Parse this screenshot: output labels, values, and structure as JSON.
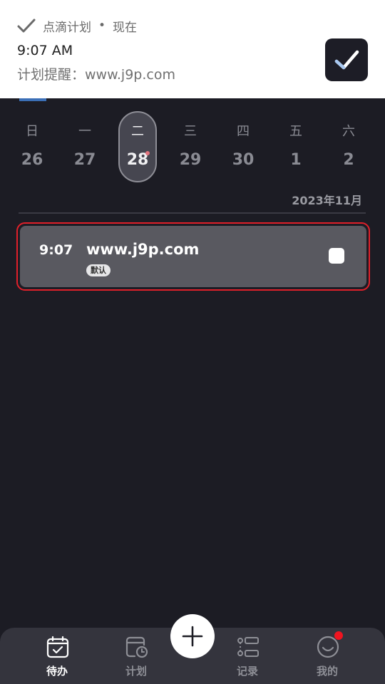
{
  "notification": {
    "app_name": "点滴计划",
    "separator": "•",
    "when": "现在",
    "time": "9:07 AM",
    "body": "计划提醒：www.j9p.com"
  },
  "calendar": {
    "days": [
      {
        "weekday": "日",
        "date": "26"
      },
      {
        "weekday": "一",
        "date": "27"
      },
      {
        "weekday": "二",
        "date": "28",
        "selected": true
      },
      {
        "weekday": "三",
        "date": "29"
      },
      {
        "weekday": "四",
        "date": "30"
      },
      {
        "weekday": "五",
        "date": "1"
      },
      {
        "weekday": "六",
        "date": "2"
      }
    ],
    "month": "2023年11月"
  },
  "task": {
    "time": "9:07",
    "title": "www.j9p.com",
    "tag": "默认"
  },
  "nav": {
    "items": [
      {
        "label": "待办",
        "icon": "todo-calendar-icon",
        "active": true
      },
      {
        "label": "计划",
        "icon": "plan-clock-icon"
      },
      {
        "label": "记录",
        "icon": "record-list-icon"
      },
      {
        "label": "我的",
        "icon": "smile-face-icon"
      }
    ],
    "add_icon": "plus-icon"
  },
  "colors": {
    "background": "#1c1c24",
    "card": "#595960",
    "highlight_border": "#e0202a",
    "badge": "#f01420",
    "event_dot": "#e2737d"
  }
}
